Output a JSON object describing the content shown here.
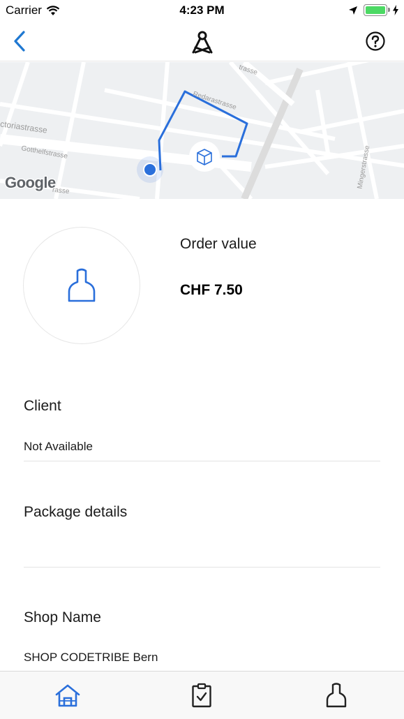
{
  "status_bar": {
    "carrier": "Carrier",
    "time": "4:23 PM",
    "battery_level": 1.0
  },
  "nav": {
    "back_icon": "chevron-left-icon",
    "logo_icon": "brand-logo-icon",
    "help_icon": "question-circle-icon"
  },
  "map": {
    "labels": {
      "street_1": "trasse",
      "street_2": "Redarastrasse",
      "street_3": "ctoriastrasse",
      "street_4": "Gotthelfstrasse",
      "street_5": "rasse",
      "street_6": "Mingerstrasse"
    },
    "attribution": "Google",
    "route_color": "#2a6fdb",
    "location_color": "#2a6fdb",
    "package_icon": "package-icon"
  },
  "order": {
    "label": "Order value",
    "value": "CHF 7.50",
    "avatar_icon": "user-icon"
  },
  "client": {
    "title": "Client",
    "value": "Not Available"
  },
  "package": {
    "title": "Package details",
    "value": ""
  },
  "shop": {
    "title": "Shop Name",
    "value": "SHOP CODETRIBE Bern"
  },
  "tab_bar": {
    "accent": "#2a6fdb",
    "items": [
      {
        "icon": "home-icon",
        "active": true
      },
      {
        "icon": "clipboard-check-icon",
        "active": false
      },
      {
        "icon": "user-icon",
        "active": false
      }
    ]
  }
}
